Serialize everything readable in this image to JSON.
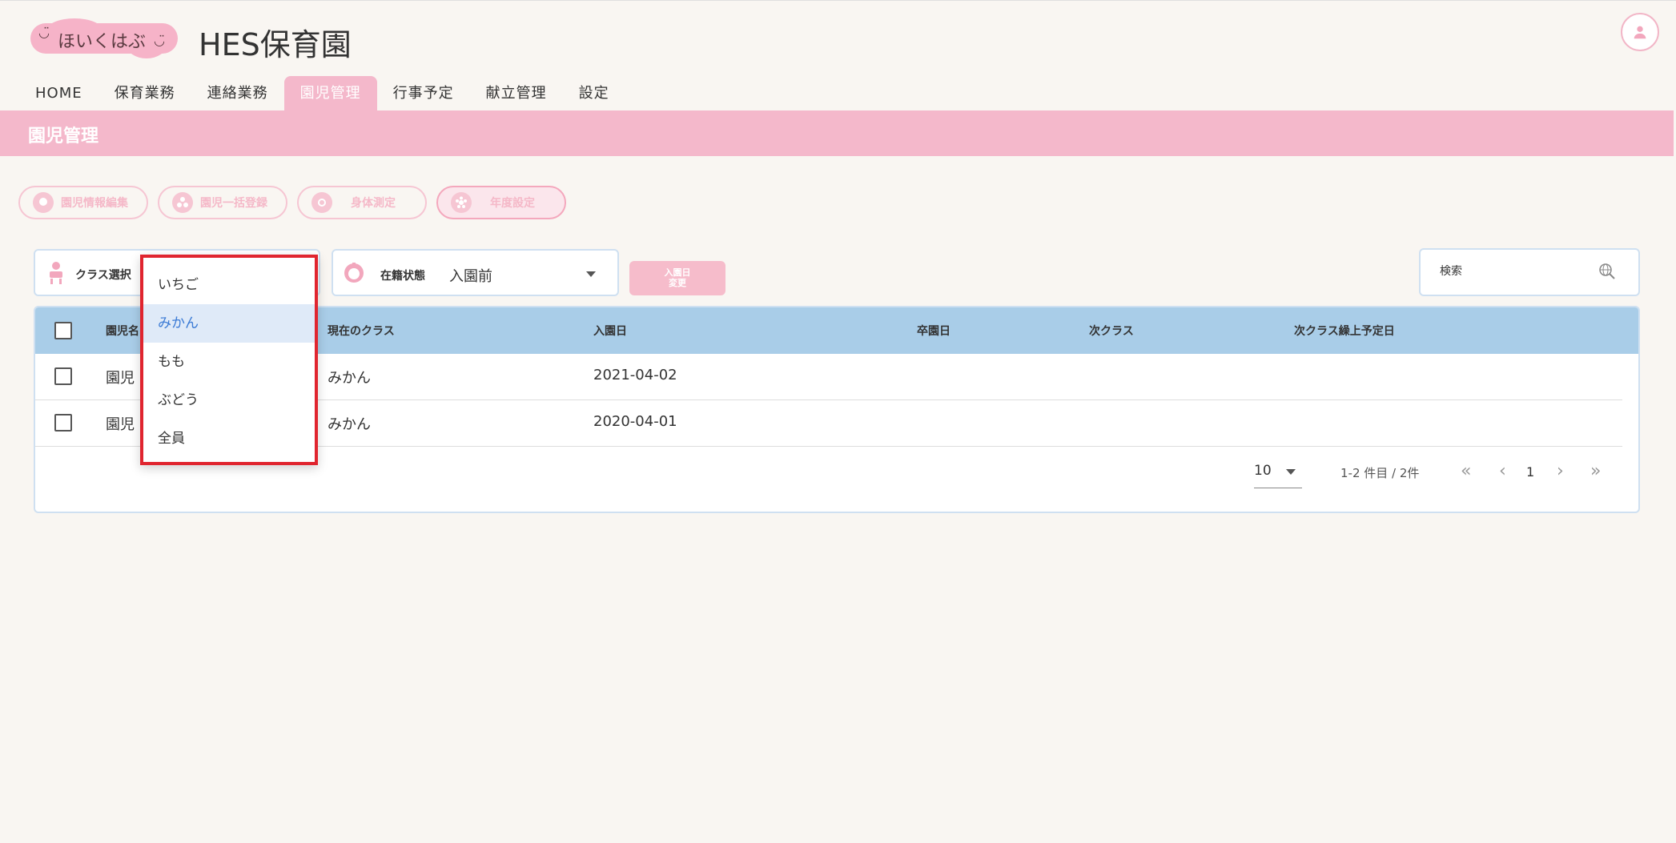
{
  "header": {
    "logo_text": "ほいくはぶ",
    "site_title": "HES保育園",
    "avatar_icon": "user-icon"
  },
  "nav": {
    "tabs": [
      {
        "label": "HOME"
      },
      {
        "label": "保育業務"
      },
      {
        "label": "連絡業務"
      },
      {
        "label": "園児管理",
        "active": true
      },
      {
        "label": "行事予定"
      },
      {
        "label": "献立管理"
      },
      {
        "label": "設定"
      }
    ]
  },
  "section": {
    "title": "園児管理"
  },
  "actions": [
    {
      "label": "園児情報編集",
      "icon": "child-icon"
    },
    {
      "label": "園児一括登録",
      "icon": "group-icon"
    },
    {
      "label": "身体測定",
      "icon": "measure-icon"
    },
    {
      "label": "年度設定",
      "icon": "gear-flower-icon"
    }
  ],
  "filters": {
    "class_label": "クラス選択",
    "status_label": "在籍状態",
    "status_value": "入園前",
    "date_change_button": [
      "入園日",
      "変更"
    ],
    "search_placeholder": "検索"
  },
  "table": {
    "headers": [
      "園児名",
      "現在のクラス",
      "入園日",
      "卒園日",
      "次クラス",
      "次クラス繰上予定日"
    ],
    "rows": [
      {
        "name": "園児 1",
        "class": "みかん",
        "entry_date": "2021-04-02",
        "graduation_date": "",
        "next_class": "",
        "next_date": ""
      },
      {
        "name": "園児 1",
        "class": "みかん",
        "entry_date": "2020-04-01",
        "graduation_date": "",
        "next_class": "",
        "next_date": ""
      }
    ]
  },
  "pagination": {
    "per_page": "10",
    "range_text": "1-2 件目 / 2件",
    "current_page": "1",
    "first": "«",
    "prev": "‹",
    "next": "›",
    "last": "»"
  },
  "dropdown": {
    "options": [
      {
        "label": "いちご"
      },
      {
        "label": "みかん",
        "selected": true
      },
      {
        "label": "もも"
      },
      {
        "label": "ぶどう"
      },
      {
        "label": "全員"
      }
    ],
    "highlight_color": "#e0252f"
  },
  "colors": {
    "accent_pink": "#f4b8cb",
    "header_blue": "#a9cde8",
    "background": "#f9f6f2"
  }
}
